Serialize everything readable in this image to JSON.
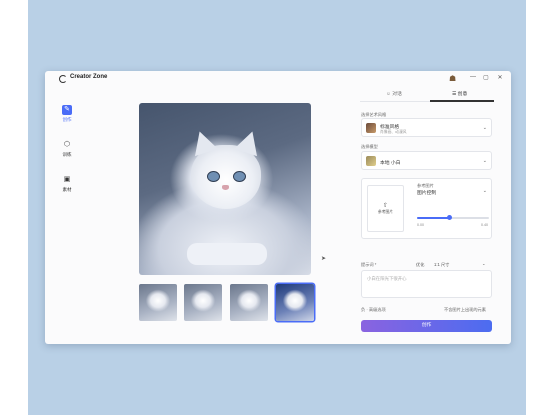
{
  "window": {
    "title": "Creator Zone",
    "controls": [
      "—",
      "▢",
      "✕"
    ]
  },
  "sidebar": {
    "items": [
      {
        "label": "创作",
        "icon": "create-icon",
        "glyph": "✎",
        "active": true
      },
      {
        "label": "训练",
        "icon": "cube-icon",
        "glyph": "⬡",
        "active": false
      },
      {
        "label": "素材",
        "icon": "folder-icon",
        "glyph": "▣",
        "active": false
      }
    ]
  },
  "panel": {
    "tabs": [
      {
        "label": "对话",
        "icon": "chat-icon",
        "glyph": "☺",
        "active": false
      },
      {
        "label": "创意",
        "icon": "sliders-icon",
        "glyph": "☰",
        "active": true
      }
    ],
    "style_label": "选择艺术风格",
    "style_name": "标准风格",
    "style_sub": "肖像画、动漫风",
    "subject_label": "选择模型",
    "subject_name": "本地 小白",
    "ref_label": "参考图片",
    "ref_mode": "图片控制",
    "upload_label": "参考图片",
    "slider_value": 0.45,
    "slider_min": "0.00",
    "slider_max": "0.40",
    "prompt_label": "提示词 *",
    "prompt_tools": [
      "优化",
      "1:1 尺寸"
    ],
    "prompt_placeholder": "小白在阳光下很开心",
    "negative_label": "负 · 高级选项",
    "negative_right": "不含图片上出现的元素",
    "generate_label": "创作"
  },
  "gallery": {
    "selected_index": 3,
    "count": 4
  }
}
